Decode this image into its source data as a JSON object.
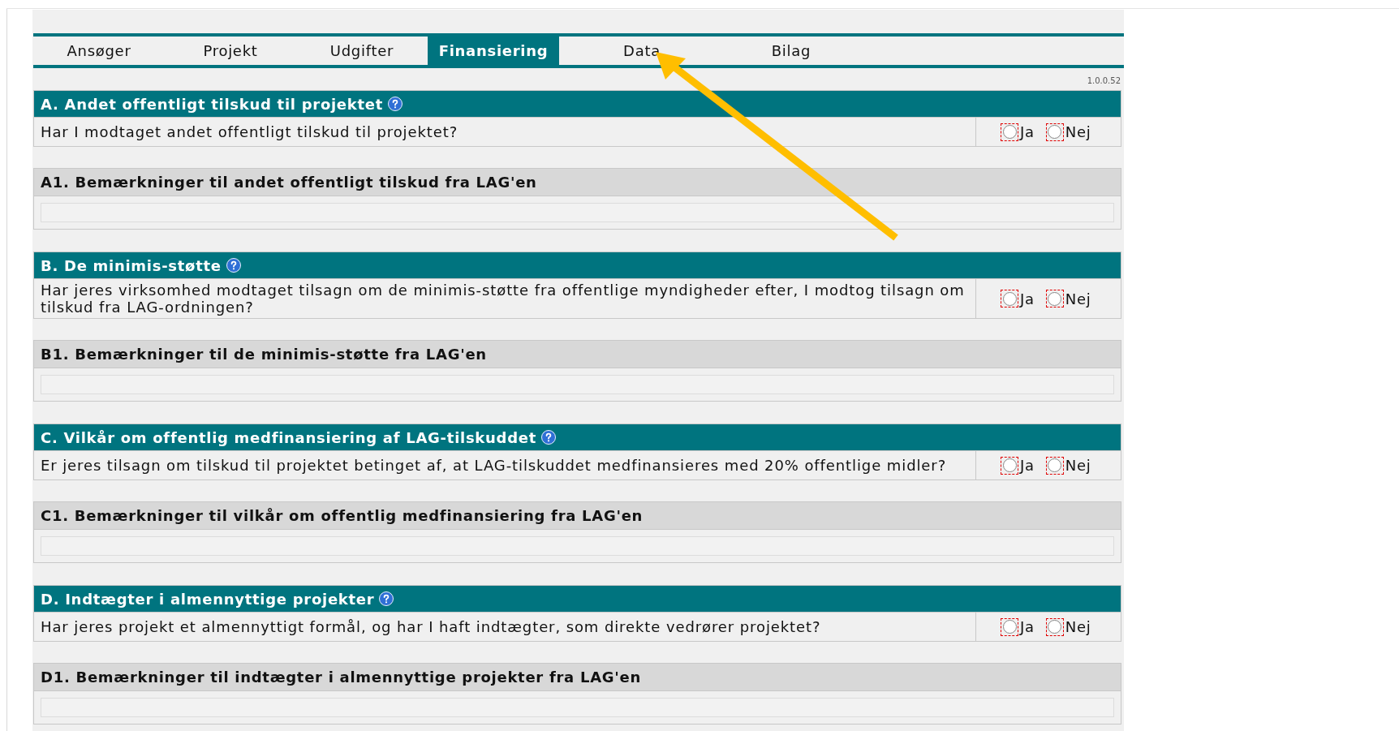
{
  "tabs": [
    {
      "label": "Ansøger",
      "selected": false
    },
    {
      "label": "Projekt",
      "selected": false
    },
    {
      "label": "Udgifter",
      "selected": false
    },
    {
      "label": "Finansiering",
      "selected": true
    },
    {
      "label": "Data",
      "selected": false
    },
    {
      "label": "Bilag",
      "selected": false
    }
  ],
  "version": "1.0.0.52",
  "sections": [
    {
      "title": "A. Andet offentligt tilskud til projektet",
      "question": "Har I modtaget andet offentligt tilskud til projektet?",
      "options": [
        {
          "label": "Ja",
          "selected": false
        },
        {
          "label": "Nej",
          "selected": false
        }
      ],
      "remarks_title": "A1. Bemærkninger til andet offentligt tilskud fra LAG'en"
    },
    {
      "title": "B. De minimis-støtte",
      "question": "Har jeres virksomhed modtaget tilsagn om de minimis-støtte fra offentlige myndigheder efter, I modtog tilsagn om tilskud fra LAG-ordningen?",
      "options": [
        {
          "label": "Ja",
          "selected": false
        },
        {
          "label": "Nej",
          "selected": false
        }
      ],
      "remarks_title": "B1. Bemærkninger til de minimis-støtte fra LAG'en"
    },
    {
      "title": "C. Vilkår om offentlig medfinansiering af LAG-tilskuddet",
      "question": "Er jeres tilsagn om tilskud til projektet betinget af, at LAG-tilskuddet medfinansieres med 20% offentlige midler?",
      "options": [
        {
          "label": "Ja",
          "selected": false
        },
        {
          "label": "Nej",
          "selected": false
        }
      ],
      "remarks_title": "C1. Bemærkninger til vilkår om offentlig medfinansiering fra LAG'en"
    },
    {
      "title": "D. Indtægter i almennyttige projekter",
      "question": "Har jeres projekt et almennyttigt formål, og har I haft indtægter, som direkte vedrører projektet?",
      "options": [
        {
          "label": "Ja",
          "selected": false
        },
        {
          "label": "Nej",
          "selected": false
        }
      ],
      "remarks_title": "D1. Bemærkninger til indtægter i almennyttige projekter fra LAG'en"
    }
  ]
}
